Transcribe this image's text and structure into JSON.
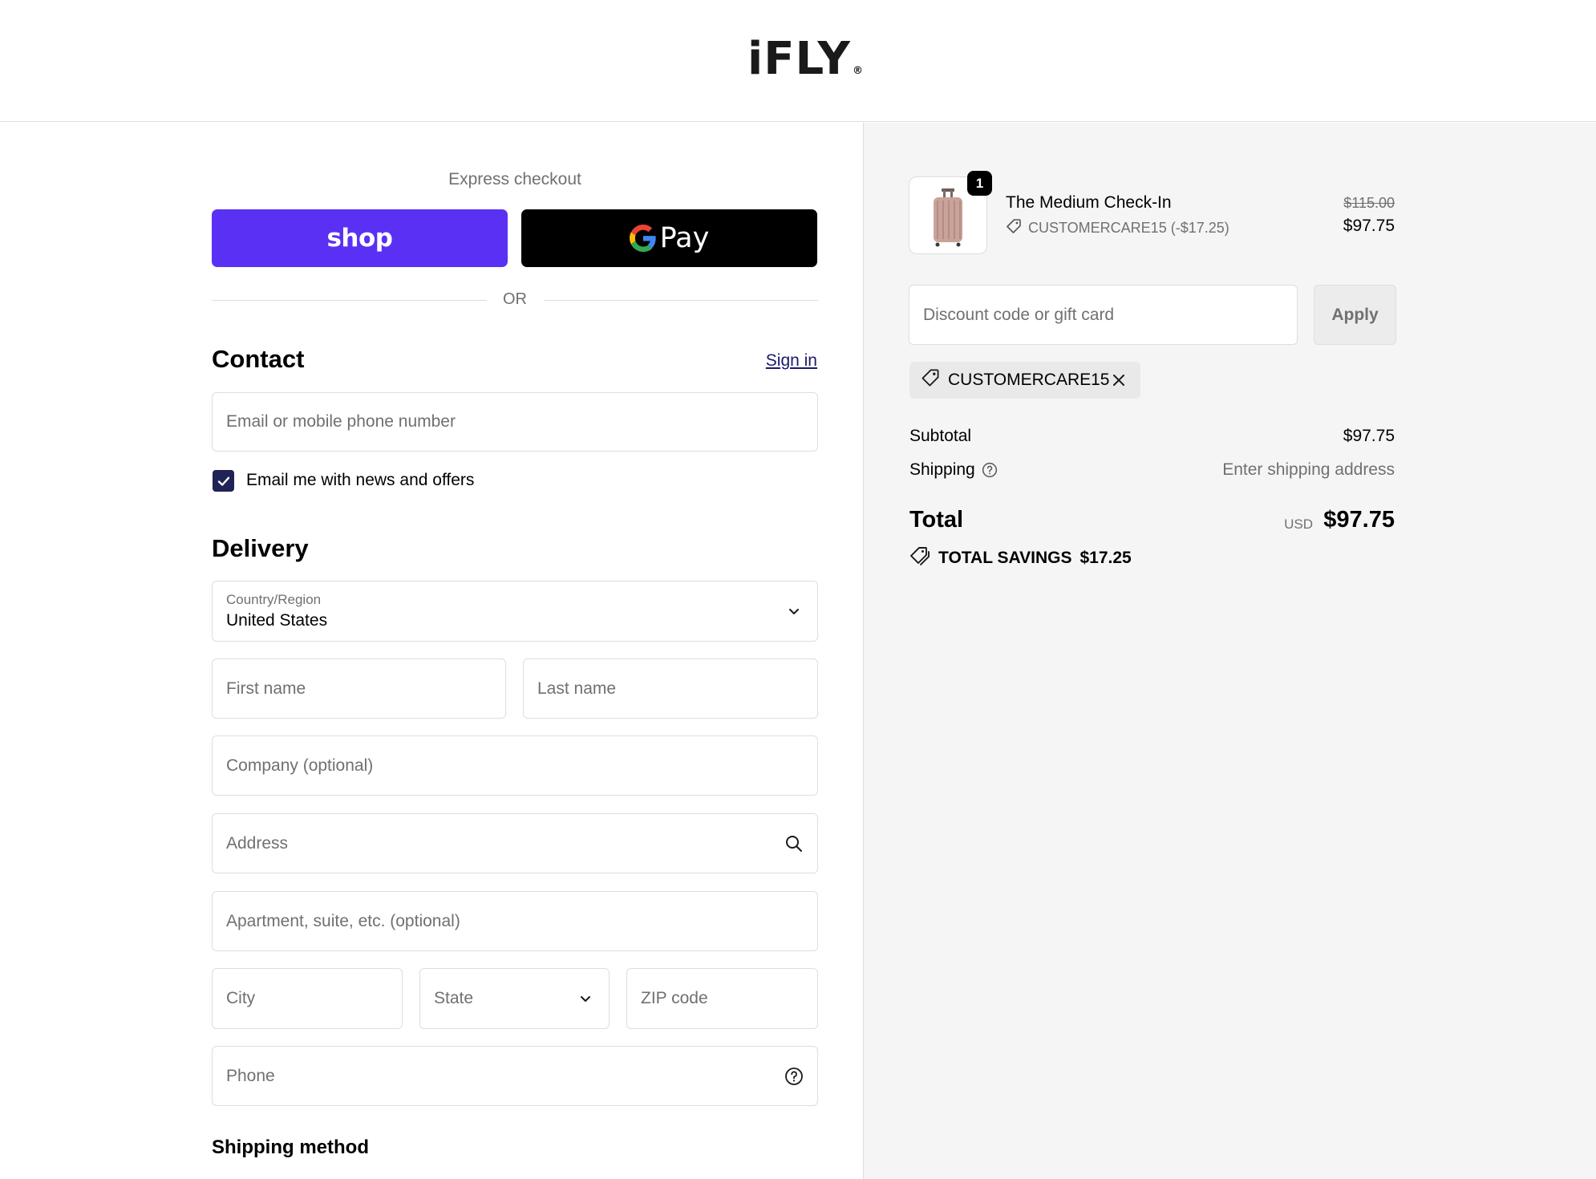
{
  "header": {
    "logo_text": "iFLY",
    "logo_mark": "®"
  },
  "express": {
    "label": "Express checkout",
    "shop_label": "shop",
    "gpay_label": "Pay",
    "or_label": "OR",
    "colors": {
      "shop": "#5a31f4",
      "gpay": "#000000"
    }
  },
  "contact": {
    "title": "Contact",
    "signin_label": "Sign in",
    "email_placeholder": "Email or mobile phone number",
    "news_checkbox_label": "Email me with news and offers",
    "news_checked": true
  },
  "delivery": {
    "title": "Delivery",
    "country_label": "Country/Region",
    "country_value": "United States",
    "first_name_placeholder": "First name",
    "last_name_placeholder": "Last name",
    "company_placeholder": "Company (optional)",
    "address_placeholder": "Address",
    "apartment_placeholder": "Apartment, suite, etc. (optional)",
    "city_placeholder": "City",
    "state_placeholder": "State",
    "zip_placeholder": "ZIP code",
    "phone_placeholder": "Phone"
  },
  "shipping_method": {
    "title": "Shipping method"
  },
  "summary": {
    "product": {
      "name": "The Medium Check-In",
      "quantity": "1",
      "discount_line": "CUSTOMERCARE15 (-$17.25)",
      "price_original": "$115.00",
      "price_final": "$97.75"
    },
    "discount_placeholder": "Discount code or gift card",
    "apply_label": "Apply",
    "applied_code": "CUSTOMERCARE15",
    "subtotal_label": "Subtotal",
    "subtotal_value": "$97.75",
    "shipping_label": "Shipping",
    "shipping_value": "Enter shipping address",
    "total_label": "Total",
    "total_currency": "USD",
    "total_value": "$97.75",
    "savings_label": "TOTAL SAVINGS",
    "savings_value": "$17.25"
  }
}
